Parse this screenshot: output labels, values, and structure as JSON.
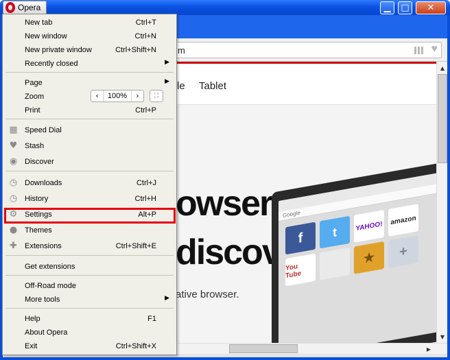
{
  "window": {
    "app_button": "Opera",
    "minimize_glyph": "▁",
    "maximize_glyph": "□",
    "close_glyph": "✕"
  },
  "address_bar": {
    "value": "m"
  },
  "page": {
    "nav": [
      "le",
      "Tablet"
    ],
    "hero_line1": "owser",
    "hero_line2": "discover",
    "hero_sub": "ative browser."
  },
  "laptop_dials": [
    "f",
    "t",
    "YAHOO!",
    "amazon",
    "You Tube",
    "",
    "★",
    "+"
  ],
  "laptop_search": "Google",
  "menu": {
    "new_tab": {
      "label": "New tab",
      "shortcut": "Ctrl+T"
    },
    "new_window": {
      "label": "New window",
      "shortcut": "Ctrl+N"
    },
    "new_private_window": {
      "label": "New private window",
      "shortcut": "Ctrl+Shift+N"
    },
    "recently_closed": {
      "label": "Recently closed",
      "submenu": "▶"
    },
    "page": {
      "label": "Page",
      "submenu": "▶"
    },
    "zoom": {
      "label": "Zoom",
      "minus": "‹",
      "value": "100%",
      "plus": "›",
      "fullscreen": "⛶"
    },
    "print": {
      "label": "Print",
      "shortcut": "Ctrl+P"
    },
    "speed_dial": {
      "label": "Speed Dial",
      "icon": "▦"
    },
    "stash": {
      "label": "Stash",
      "icon": "♥"
    },
    "discover": {
      "label": "Discover",
      "icon": "◉"
    },
    "downloads": {
      "label": "Downloads",
      "shortcut": "Ctrl+J",
      "icon": "◷"
    },
    "history": {
      "label": "History",
      "shortcut": "Ctrl+H",
      "icon": "◷"
    },
    "settings": {
      "label": "Settings",
      "shortcut": "Alt+P",
      "icon": "⚙"
    },
    "themes": {
      "label": "Themes",
      "icon": "●"
    },
    "extensions": {
      "label": "Extensions",
      "shortcut": "Ctrl+Shift+E",
      "icon": "✚"
    },
    "get_extensions": {
      "label": "Get extensions"
    },
    "off_road": {
      "label": "Off-Road mode"
    },
    "more_tools": {
      "label": "More tools",
      "submenu": "▶"
    },
    "help": {
      "label": "Help",
      "shortcut": "F1"
    },
    "about": {
      "label": "About Opera"
    },
    "exit": {
      "label": "Exit",
      "shortcut": "Ctrl+Shift+X"
    }
  },
  "scroll": {
    "up": "▲",
    "down": "▼",
    "left": "◀",
    "right": "▶"
  },
  "colors": {
    "accent": "#cc0f16",
    "highlight": "#e4000f",
    "titlebar": "#0a52e3"
  }
}
